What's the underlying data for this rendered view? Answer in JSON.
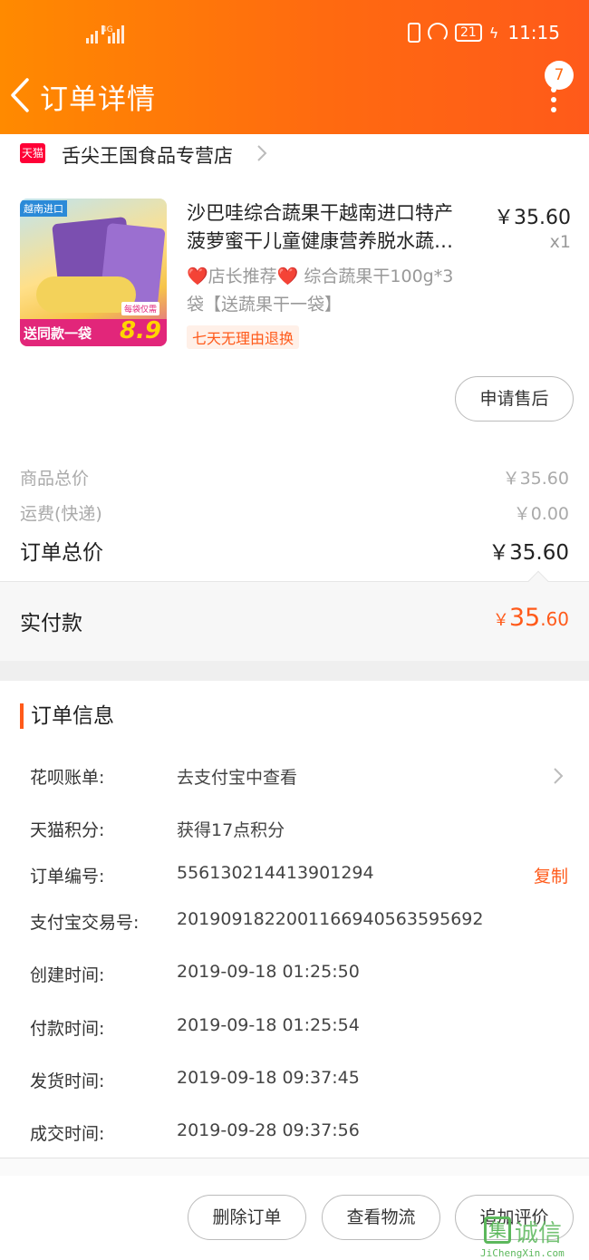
{
  "status_bar": {
    "network": "4G",
    "battery": "21",
    "time": "11:15"
  },
  "header": {
    "title": "订单详情",
    "badge_count": "7"
  },
  "shop": {
    "logo_text": "天猫",
    "name": "舌尖王国食品专营店"
  },
  "product": {
    "thumb_tag": "越南进口",
    "thumb_banner": "送同款一袋",
    "thumb_price": "8.9",
    "thumb_note": "每袋仅需",
    "title_line1": "沙巴哇综合蔬果干越南进口特产",
    "title_line2": "菠萝蜜干儿童健康营养脱水蔬…",
    "price": "￥35.60",
    "qty": "x1",
    "sku_heart": "❤️",
    "sku_mid": "店长推荐",
    "sku_rest": " 综合蔬果干100g*3",
    "sku_line2": "袋【送蔬果干一袋】",
    "tag": "七天无理由退换",
    "after_sale_button": "申请售后"
  },
  "totals": {
    "goods_label": "商品总价",
    "goods_value": "￥35.60",
    "shipping_label": "运费(快递)",
    "shipping_value": "￥0.00",
    "order_total_label": "订单总价",
    "order_total_value": "￥35.60",
    "paid_label": "实付款",
    "paid_currency": "￥",
    "paid_int": "35",
    "paid_dec": ".60"
  },
  "order_info": {
    "title": "订单信息",
    "rows": [
      {
        "label": "花呗账单:",
        "value": "去支付宝中查看"
      },
      {
        "label": "天猫积分:",
        "value": "获得17点积分"
      },
      {
        "label": "订单编号:",
        "value": "556130214413901294",
        "action": "复制"
      },
      {
        "label": "支付宝交易号:",
        "value": "2019091822001166940563595692"
      },
      {
        "label": "创建时间:",
        "value": "2019-09-18 01:25:50"
      },
      {
        "label": "付款时间:",
        "value": "2019-09-18 01:25:54"
      },
      {
        "label": "发货时间:",
        "value": "2019-09-18 09:37:45"
      },
      {
        "label": "成交时间:",
        "value": "2019-09-28 09:37:56"
      }
    ]
  },
  "bottom_actions": {
    "delete": "删除订单",
    "logistics": "查看物流",
    "review": "追加评价"
  },
  "watermark": {
    "box": "集",
    "cn": "诚信",
    "en": "JiChengXin.com"
  },
  "colors": {
    "accent": "#ff5a1a",
    "header_start": "#ff8a00",
    "header_end": "#ff5a1a",
    "tmall_red": "#ff0036"
  }
}
